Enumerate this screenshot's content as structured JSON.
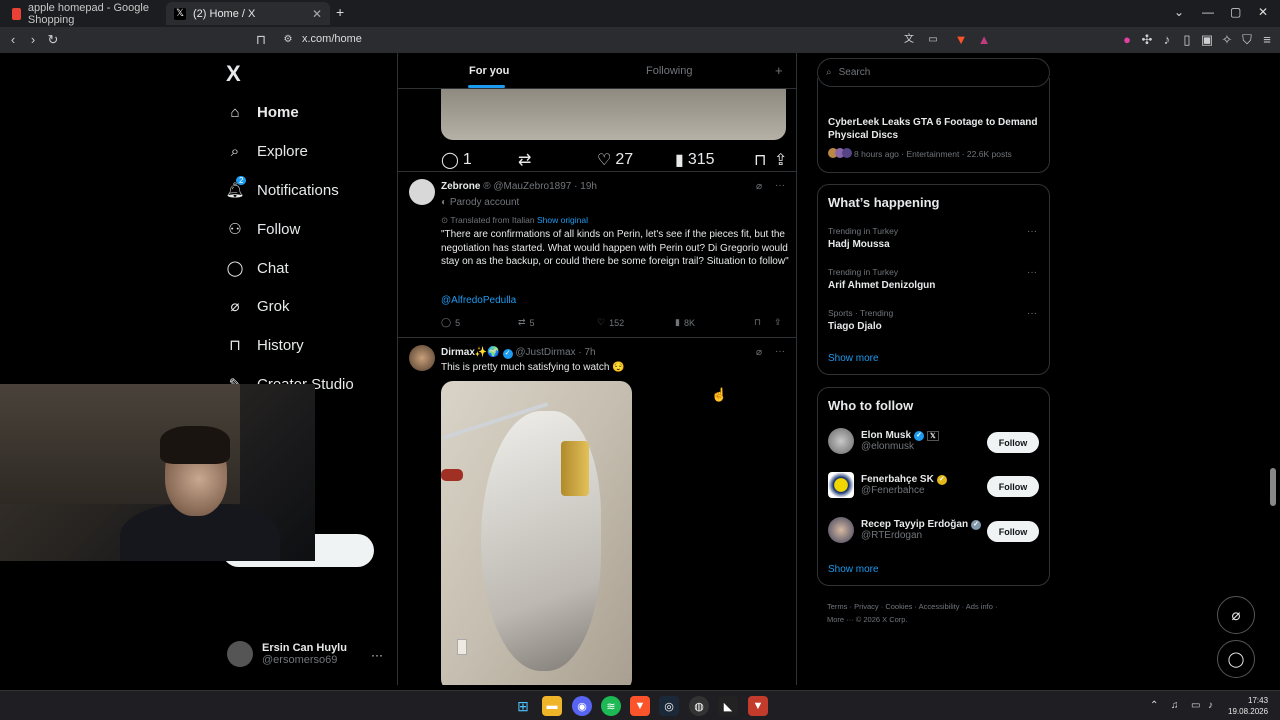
{
  "browser": {
    "tabs": [
      {
        "title": "apple homepad - Google Shopping",
        "active": false
      },
      {
        "title": "(2) Home / X",
        "active": true
      }
    ],
    "new_tab": "+",
    "url": "x.com/home"
  },
  "nav": {
    "logo": "X",
    "items": [
      {
        "label": "Home",
        "icon": "home-icon"
      },
      {
        "label": "Explore",
        "icon": "search-icon"
      },
      {
        "label": "Notifications",
        "icon": "bell-icon",
        "badge": "2"
      },
      {
        "label": "Follow",
        "icon": "person-plus-icon"
      },
      {
        "label": "Chat",
        "icon": "chat-icon"
      },
      {
        "label": "Grok",
        "icon": "grok-icon"
      },
      {
        "label": "History",
        "icon": "bookmark-icon"
      },
      {
        "label": "Creator Studio",
        "icon": "creator-icon"
      }
    ],
    "profile": {
      "name": "Ersin Can Huylu",
      "handle": "@ersomerso69",
      "more": "···"
    }
  },
  "timeline": {
    "tabs": [
      "For you",
      "Following"
    ],
    "add_tab": "+",
    "first_post_actions": {
      "replies": "1",
      "reposts": "",
      "likes": "27",
      "views": "315"
    },
    "posts": [
      {
        "name": "Zebrone",
        "handle_time": "@MauZebro1897 · 19h",
        "label": "Parody account",
        "translated": "Translated from Italian",
        "show_original": "Show original",
        "text": "\"There are confirmations of all kinds on Perin, let's see if the pieces fit, but the negotiation has started. What would happen with Perin out? Di Gregorio would stay on as the backup, or could there be some foreign trail? Situation to follow\"",
        "mention": "@AlfredoPedulla",
        "replies": "5",
        "reposts": "5",
        "likes": "152",
        "views": "8K"
      },
      {
        "name": "Dirmax✨🌍",
        "handle_time": "@JustDirmax · 7h",
        "text": "This is pretty much satisfying to watch 😌"
      }
    ]
  },
  "right": {
    "search_placeholder": "Search",
    "news": {
      "title": "CyberLeek Leaks GTA 6 Footage to Demand Physical Discs",
      "meta": "8 hours ago · Entertainment · 22.6K posts"
    },
    "happening": {
      "title": "What’s happening",
      "trends": [
        {
          "meta": "Trending in Turkey",
          "name": "Hadj Moussa"
        },
        {
          "meta": "Trending in Turkey",
          "name": "Arif Ahmet Denizolgun"
        },
        {
          "meta": "Sports · Trending",
          "name": "Tiago Djalo"
        }
      ],
      "show_more": "Show more"
    },
    "who_to_follow": {
      "title": "Who to follow",
      "users": [
        {
          "name": "Elon Musk",
          "handle": "@elonmusk",
          "badge": "blue",
          "button": "Follow"
        },
        {
          "name": "Fenerbahçe SK",
          "handle": "@Fenerbahce",
          "badge": "gold",
          "button": "Follow"
        },
        {
          "name": "Recep Tayyip Erdoğan",
          "handle": "@RTErdogan",
          "badge": "gray",
          "button": "Follow"
        }
      ],
      "show_more": "Show more"
    },
    "footer_line1": "Terms · Privacy · Cookies · Accessibility · Ads info ·",
    "footer_line2": "More ··· © 2026 X Corp."
  },
  "taskbar": {
    "time": "17:43",
    "date": "19.08.2026"
  },
  "colors": {
    "accent": "#1d9bf0",
    "background": "#000000",
    "border": "#2f3336",
    "muted": "#71767b"
  }
}
